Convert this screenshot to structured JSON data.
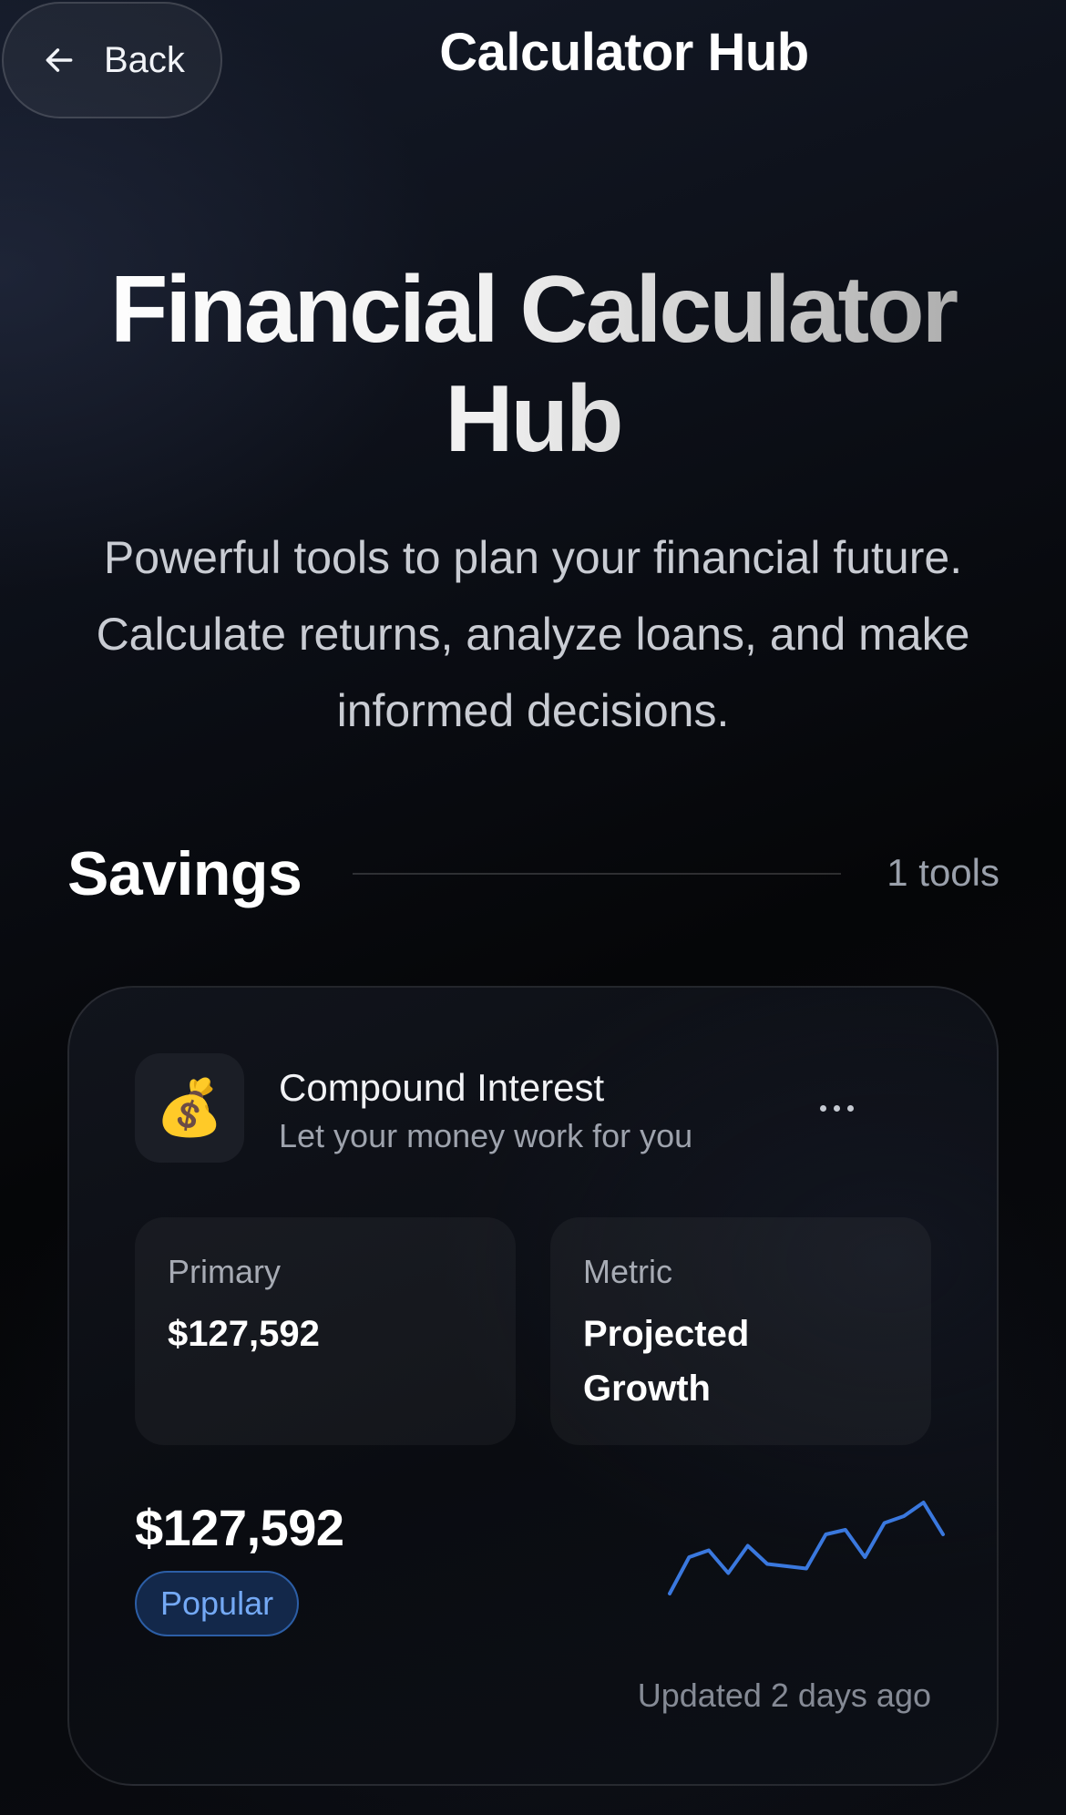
{
  "header": {
    "back_label": "Back",
    "title": "Calculator Hub"
  },
  "hero": {
    "title_line1": "Financial Calculator",
    "title_line2": "Hub",
    "subtitle_line1": "Powerful tools to plan your financial future.",
    "subtitle_line2": "Calculate returns, analyze loans, and make",
    "subtitle_line3": "informed decisions."
  },
  "section": {
    "title": "Savings",
    "count": "1 tools"
  },
  "tool": {
    "icon": "money-bag-icon",
    "icon_glyph": "💰",
    "name": "Compound Interest",
    "tagline": "Let your money work for you",
    "primary_label": "Primary",
    "primary_value": "$127,592",
    "metric_label": "Metric",
    "metric_value_line1": "Projected",
    "metric_value_line2": "Growth",
    "big_value": "$127,592",
    "badge": "Popular",
    "updated": "Updated 2 days ago",
    "sparkline_values": [
      10,
      42,
      48,
      28,
      52,
      36,
      34,
      32,
      62,
      66,
      42,
      72,
      78,
      90,
      62
    ],
    "sparkline_color": "#3a78de"
  },
  "colors": {
    "accent": "#3a78de",
    "badge_bg": "#13284a",
    "badge_text": "#74a9f5"
  }
}
